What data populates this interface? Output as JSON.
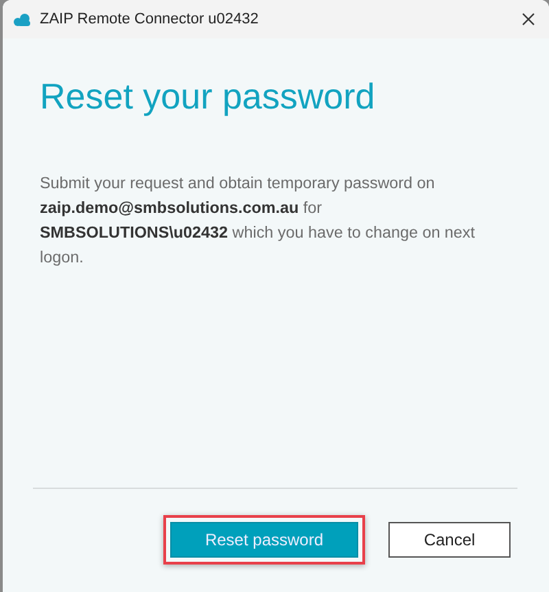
{
  "window": {
    "title": "ZAIP Remote Connector u02432"
  },
  "heading": "Reset your password",
  "message": "Submit your request and obtain temporary password on **zaip.demo@smbsolutions.com.au** for **SMBSOLUTIONS\\u02432** which you have to change on next logon.",
  "buttons": [
    {
      "label": "Reset password",
      "kind": "primary",
      "highlighted": true
    },
    {
      "label": "Cancel",
      "kind": "secondary",
      "highlighted": false
    }
  ]
}
